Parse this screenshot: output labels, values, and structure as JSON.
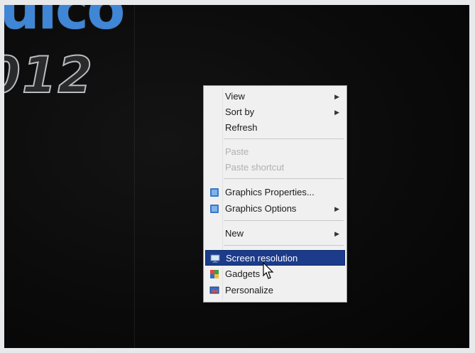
{
  "wallpaper": {
    "logo_top": "uico",
    "logo_year": "012"
  },
  "context_menu": {
    "items": [
      {
        "label": "View",
        "has_submenu": true
      },
      {
        "label": "Sort by",
        "has_submenu": true
      },
      {
        "label": "Refresh"
      },
      {
        "label": "Paste",
        "disabled": true
      },
      {
        "label": "Paste shortcut",
        "disabled": true
      },
      {
        "label": "Graphics Properties...",
        "icon": "graphics-icon"
      },
      {
        "label": "Graphics Options",
        "icon": "graphics-icon",
        "has_submenu": true
      },
      {
        "label": "New",
        "has_submenu": true
      },
      {
        "label": "Screen resolution",
        "icon": "monitor-icon",
        "highlighted": true
      },
      {
        "label": "Gadgets",
        "icon": "gadgets-icon"
      },
      {
        "label": "Personalize",
        "icon": "personalize-icon"
      }
    ],
    "submenu_arrow": "▶"
  },
  "colors": {
    "highlight": "#1c3b8a",
    "menu_background": "#f0f0f0",
    "wallpaper_accent": "#3f86d6"
  }
}
